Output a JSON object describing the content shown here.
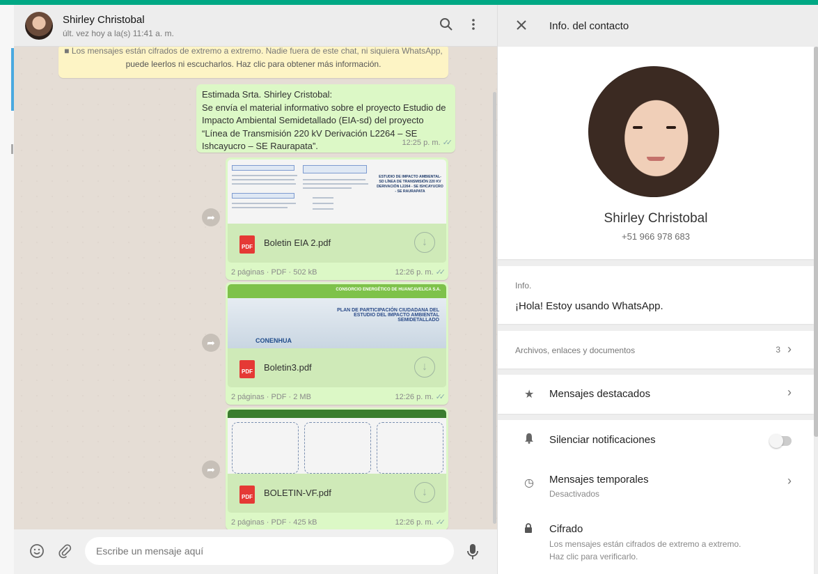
{
  "chat": {
    "contact_name": "Shirley Christobal",
    "status": "últ. vez hoy a la(s) 11:41 a. m.",
    "encryption_line1": "■ Los mensajes están cifrados de extremo a extremo. Nadie fuera de este chat, ni siquiera WhatsApp,",
    "encryption_line2": "puede leerlos ni escucharlos. Haz clic para obtener más información.",
    "message_text": "Estimada Srta. Shirley Cristobal:\nSe envía el material informativo sobre el proyecto Estudio de Impacto Ambiental Semidetallado (EIA-sd) del proyecto “Línea de Transmisión 220 kV Derivación L2264 – SE Ishcayucro – SE Raurapata”.",
    "message_time": "12:25 p. m.",
    "documents": [
      {
        "name": "Boletin EIA 2.pdf",
        "meta": "2 páginas · PDF · 502 kB",
        "time": "12:26 p. m.",
        "thumb_text": "ESTUDIO DE IMPACTO AMBIENTAL-SD LÍNEA DE TRANSMISIÓN 220 KV DERIVACIÓN L2264 - SE ISHCAYUCRO - SE RAURAPATA"
      },
      {
        "name": "Boletin3.pdf",
        "meta": "2 páginas · PDF · 2 MB",
        "time": "12:26 p. m.",
        "thumb_header": "CONSORCIO ENERGÉTICO DE HUANCAVELICA S.A.",
        "thumb_text": "PLAN DE PARTICIPACIÓN CIUDADANA DEL ESTUDIO DEL IMPACTO AMBIENTAL SEMIDETALLADO",
        "thumb_logo": "CONENHUA"
      },
      {
        "name": "BOLETIN-VF.pdf",
        "meta": "2 páginas · PDF · 425 kB",
        "time": "12:26 p. m."
      }
    ],
    "pdf_badge": "PDF",
    "composer_placeholder": "Escribe un mensaje aquí"
  },
  "info": {
    "title": "Info. del contacto",
    "name": "Shirley Christobal",
    "phone": "+51 966 978 683",
    "about_label": "Info.",
    "about_text": "¡Hola! Estoy usando WhatsApp.",
    "media_label": "Archivos, enlaces y documentos",
    "media_count": "3",
    "starred_label": "Mensajes destacados",
    "mute_label": "Silenciar notificaciones",
    "mute_on": false,
    "disappearing_label": "Mensajes temporales",
    "disappearing_sub": "Desactivados",
    "encryption_label": "Cifrado",
    "encryption_sub1": "Los mensajes están cifrados de extremo a extremo.",
    "encryption_sub2": "Haz clic para verificarlo."
  },
  "colors": {
    "accent": "#00a884",
    "bubble_out": "#dcf8c6",
    "notice": "#fdf4c5",
    "pdf": "#e53935"
  },
  "icons": [
    "search-icon",
    "menu-icon",
    "close-icon",
    "forward-icon",
    "download-icon",
    "emoji-icon",
    "attach-icon",
    "mic-icon",
    "star-icon",
    "bell-icon",
    "timer-icon",
    "lock-icon",
    "chevron-right-icon"
  ]
}
